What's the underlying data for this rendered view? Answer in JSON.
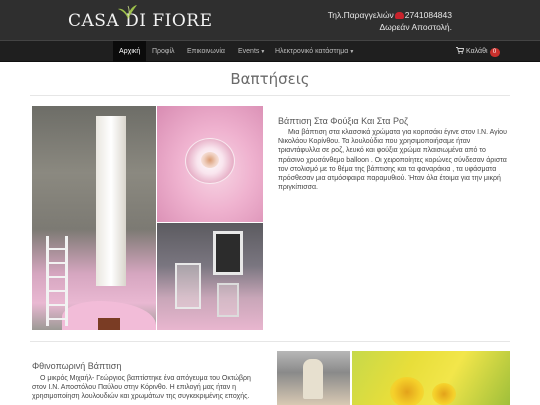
{
  "header": {
    "logo_text": "CASA DI FIORE",
    "contact_line1_prefix": "Τηλ.Παραγγελιών",
    "contact_phone": "2741084843",
    "contact_line2": "Δωρεάν Αποστολή."
  },
  "nav": {
    "items": [
      {
        "label": "Αρχική",
        "active": true
      },
      {
        "label": "Προφίλ",
        "active": false
      },
      {
        "label": "Επικοινωνία",
        "active": false
      },
      {
        "label": "Events",
        "active": false
      },
      {
        "label": "Ηλεκτρονικό κατάστημα",
        "active": false
      }
    ],
    "cart_label": "Καλάθι",
    "cart_count": "0"
  },
  "page": {
    "title": "Βαπτήσεις"
  },
  "articles": [
    {
      "title": "Βάπτιση Στα Φούξια Και Στα Ροζ",
      "body": "Μια βάπτιση στα κλασσικά χρώματα για κοριτσάκι έγινε στον Ι.Ν. Αγίου Νικολάου Κορίνθου. Τα λουλούδια που χρησιμοποιήσαμε ήταν τριαντάφυλλα σε ροζ, λευκό και φούξια χρώμα πλαισιωμένα από το πράσινο χρυσάνθεμο balloon . Οι χειροποίητες κορώνες σύνδεσαν άριστα τον στολισμό με το θέμα της βάπτισης και τα φαναράκια , τα υφάσματα πρόσθεσαν μια ατμόσφαιρα παραμυθιού. Ήταν όλα έτοιμα για την μικρή πριγκίπισσα."
    },
    {
      "title": "Φθινοπωρινή Βάπτιση",
      "body": "Ο μικρός Μιχαήλ- Γεώργιος βαπτίστηκε ένα απόγευμα του Οκτώβρη στον Ι.Ν. Αποστόλου Παύλου στην Κόρινθο. Η επιλογή μας ήταν η χρησιμοποίηση λουλουδιών και χρωμάτων της συγκεκριμένης εποχής."
    }
  ],
  "colors": {
    "topbar": "#2f2f2f",
    "navbar": "#1f1f1f",
    "nav_active": "#0b0b0b",
    "badge": "#c9302c",
    "phone_icon": "#c8232c"
  }
}
